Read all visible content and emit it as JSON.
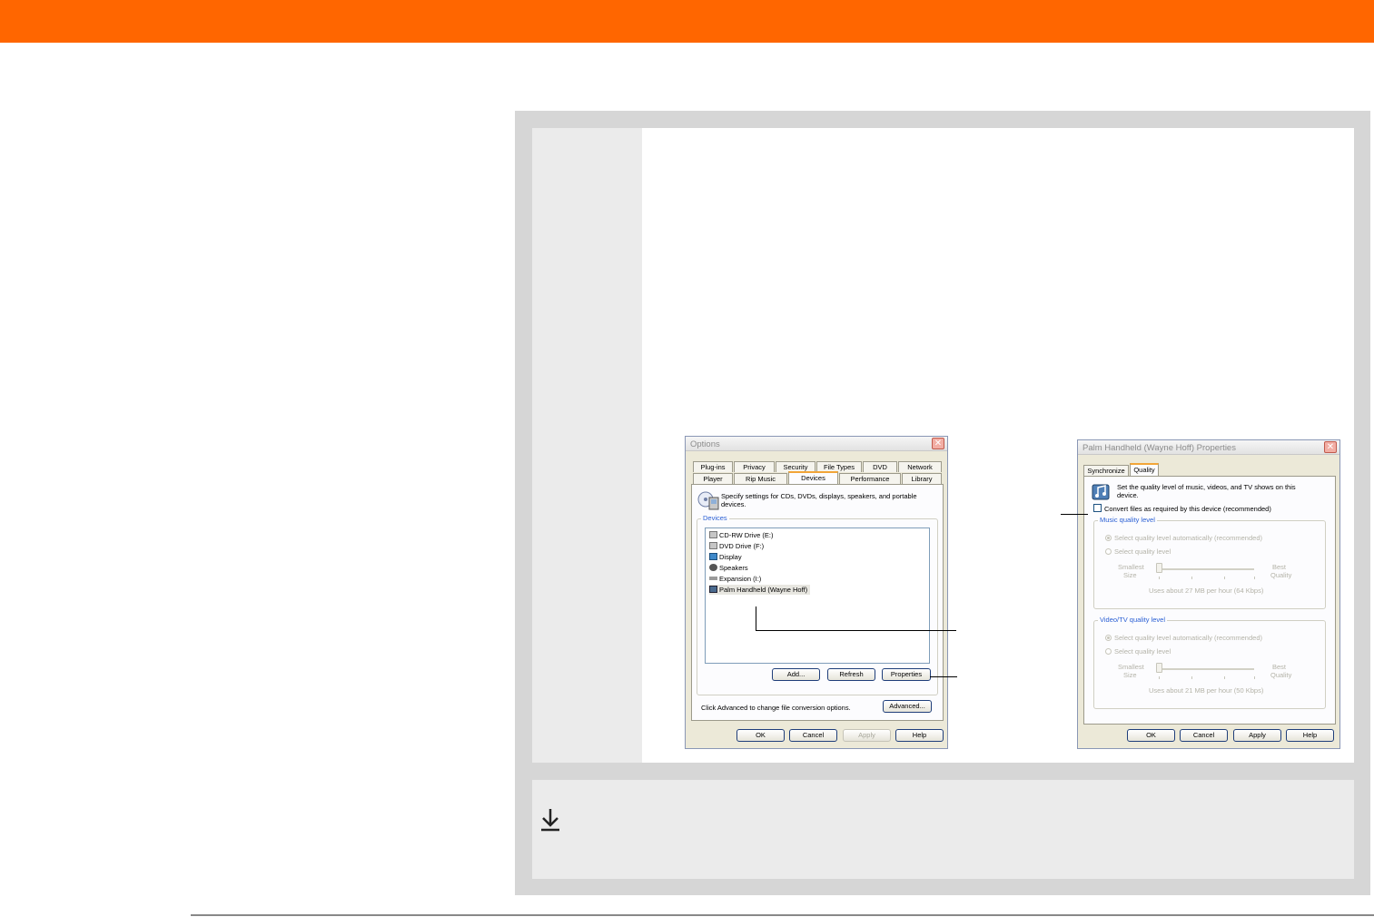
{
  "colors": {
    "header_bar": "#ff6600",
    "outer_panel": "#d6d6d6",
    "step_column": "#ebebeb",
    "tip_panel": "#ebebeb"
  },
  "icons": {
    "tip": "download-arrow-icon"
  },
  "options_dialog": {
    "title": "Options",
    "tabs_row1": [
      "Plug-ins",
      "Privacy",
      "Security",
      "File Types",
      "DVD",
      "Network"
    ],
    "tabs_row2": [
      "Player",
      "Rip Music",
      "Devices",
      "Performance",
      "Library"
    ],
    "active_tab": "Devices",
    "description_line1": "Specify settings for CDs, DVDs, displays, speakers, and portable",
    "description_line2": "devices.",
    "devices_group_label": "Devices",
    "devices": [
      "CD-RW Drive (E:)",
      "DVD Drive (F:)",
      "Display",
      "Speakers",
      "Expansion (I:)",
      "Palm Handheld (Wayne Hoff)"
    ],
    "selected_device": "Palm Handheld (Wayne Hoff)",
    "add_button": "Add...",
    "refresh_button": "Refresh",
    "properties_button": "Properties",
    "advanced_text": "Click Advanced to change file conversion options.",
    "advanced_button": "Advanced...",
    "ok_button": "OK",
    "cancel_button": "Cancel",
    "apply_button": "Apply",
    "help_button": "Help"
  },
  "properties_dialog": {
    "title": "Palm Handheld (Wayne Hoff) Properties",
    "tabs": [
      "Synchronize",
      "Quality"
    ],
    "active_tab": "Quality",
    "description_line1": "Set the quality level of music, videos, and TV shows on this",
    "description_line2": "device.",
    "convert_checkbox_label": "Convert files as required by this device (recommended)",
    "convert_checked": false,
    "music_group_label": "Music quality level",
    "music_auto_option": "Select quality level automatically (recommended)",
    "music_manual_option": "Select quality level",
    "music_smallest_label_1": "Smallest",
    "music_smallest_label_2": "Size",
    "music_best_label_1": "Best",
    "music_best_label_2": "Quality",
    "music_usage": "Uses about 27 MB per hour (64 Kbps)",
    "video_group_label": "Video/TV quality level",
    "video_auto_option": "Select quality level automatically (recommended)",
    "video_manual_option": "Select quality level",
    "video_smallest_label_1": "Smallest",
    "video_smallest_label_2": "Size",
    "video_best_label_1": "Best",
    "video_best_label_2": "Quality",
    "video_usage": "Uses about 21 MB per hour (50 Kbps)",
    "ok_button": "OK",
    "cancel_button": "Cancel",
    "apply_button": "Apply",
    "help_button": "Help"
  }
}
